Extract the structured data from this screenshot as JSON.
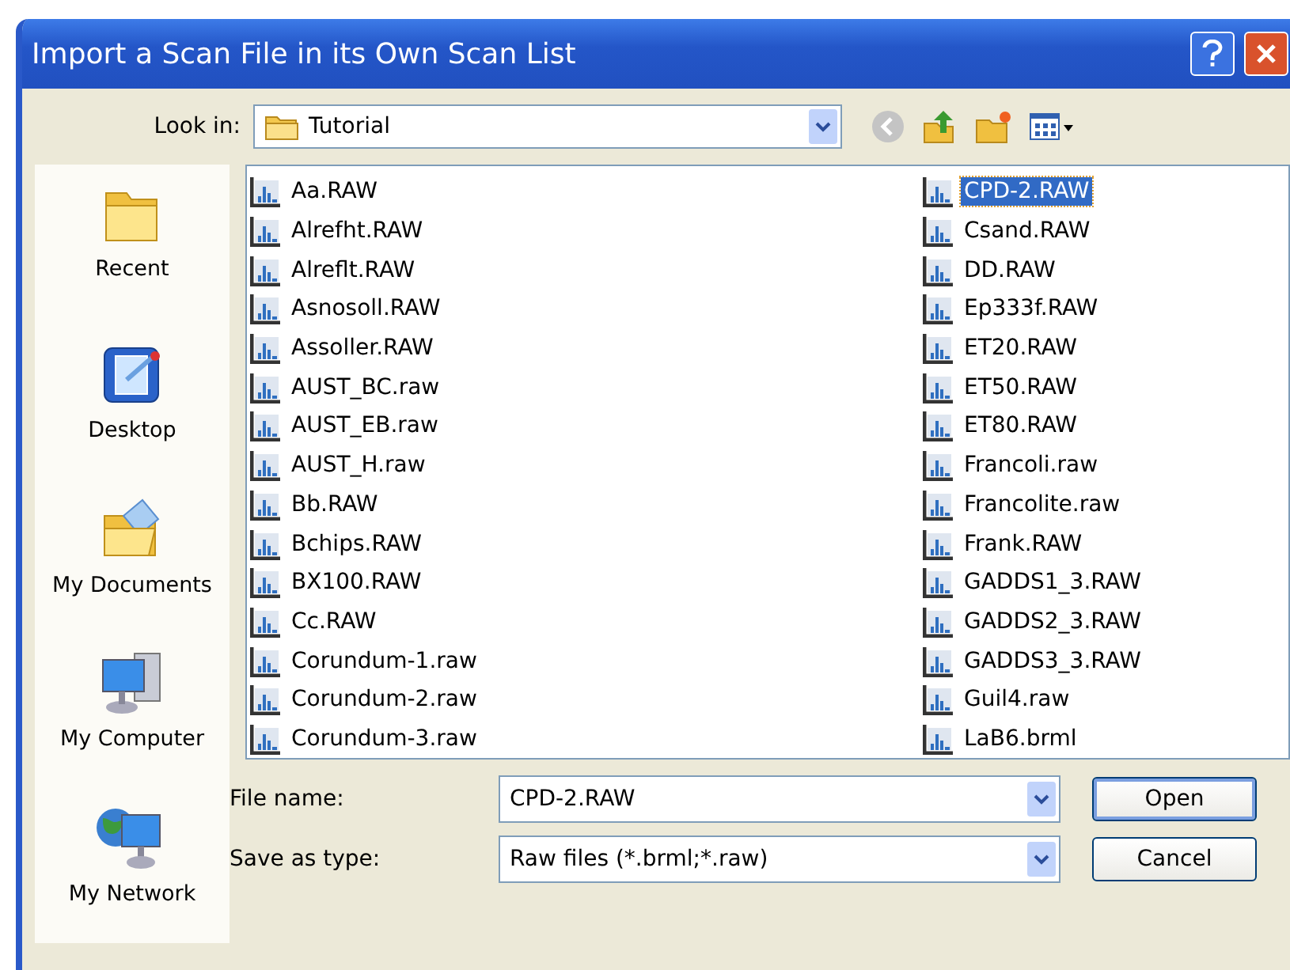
{
  "window": {
    "title": "Import a Scan File in its Own Scan List"
  },
  "look_in": {
    "label": "Look in:",
    "value": "Tutorial"
  },
  "places": [
    {
      "label": "Recent",
      "kind": "recent"
    },
    {
      "label": "Desktop",
      "kind": "desktop"
    },
    {
      "label": "My Documents",
      "kind": "documents"
    },
    {
      "label": "My Computer",
      "kind": "computer"
    },
    {
      "label": "My Network",
      "kind": "network"
    }
  ],
  "files": [
    {
      "name": "Aa.RAW",
      "selected": false
    },
    {
      "name": "Alrefht.RAW",
      "selected": false
    },
    {
      "name": "Alreflt.RAW",
      "selected": false
    },
    {
      "name": "Asnosoll.RAW",
      "selected": false
    },
    {
      "name": "Assoller.RAW",
      "selected": false
    },
    {
      "name": "AUST_BC.raw",
      "selected": false
    },
    {
      "name": "AUST_EB.raw",
      "selected": false
    },
    {
      "name": "AUST_H.raw",
      "selected": false
    },
    {
      "name": "Bb.RAW",
      "selected": false
    },
    {
      "name": "Bchips.RAW",
      "selected": false
    },
    {
      "name": "BX100.RAW",
      "selected": false
    },
    {
      "name": "Cc.RAW",
      "selected": false
    },
    {
      "name": "Corundum-1.raw",
      "selected": false
    },
    {
      "name": "Corundum-2.raw",
      "selected": false
    },
    {
      "name": "Corundum-3.raw",
      "selected": false
    },
    {
      "name": "CPD-2.RAW",
      "selected": true
    },
    {
      "name": "Csand.RAW",
      "selected": false
    },
    {
      "name": "DD.RAW",
      "selected": false
    },
    {
      "name": "Ep333f.RAW",
      "selected": false
    },
    {
      "name": "ET20.RAW",
      "selected": false
    },
    {
      "name": "ET50.RAW",
      "selected": false
    },
    {
      "name": "ET80.RAW",
      "selected": false
    },
    {
      "name": "Francoli.raw",
      "selected": false
    },
    {
      "name": "Francolite.raw",
      "selected": false
    },
    {
      "name": "Frank.RAW",
      "selected": false
    },
    {
      "name": "GADDS1_3.RAW",
      "selected": false
    },
    {
      "name": "GADDS2_3.RAW",
      "selected": false
    },
    {
      "name": "GADDS3_3.RAW",
      "selected": false
    },
    {
      "name": "Guil4.raw",
      "selected": false
    },
    {
      "name": "LaB6.brml",
      "selected": false
    }
  ],
  "file_name": {
    "label": "File name:",
    "value": "CPD-2.RAW"
  },
  "file_type": {
    "label": "Save as type:",
    "value": "Raw files (*.brml;*.raw)"
  },
  "buttons": [
    {
      "label": "Open",
      "default": true
    },
    {
      "label": "Cancel",
      "default": false
    }
  ]
}
